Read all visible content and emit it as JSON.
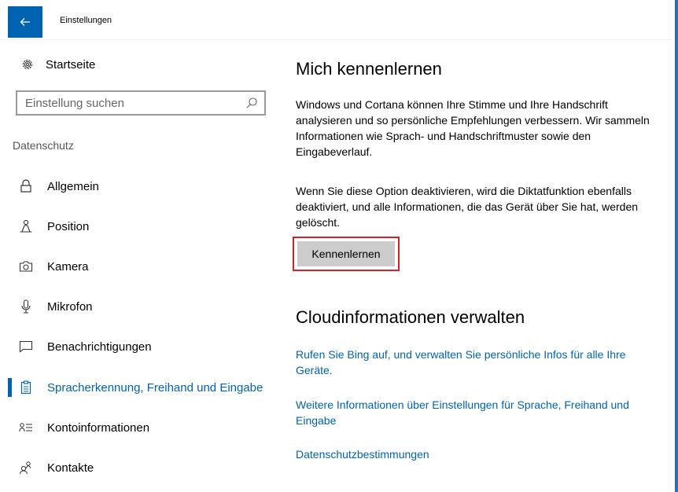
{
  "window": {
    "title": "Einstellungen",
    "back_icon": "back-arrow-icon",
    "accent": "#0063b1"
  },
  "sidebar": {
    "home_label": "Startseite",
    "search_placeholder": "Einstellung suchen",
    "section_title": "Datenschutz",
    "items": [
      {
        "label": "Allgemein",
        "icon": "lock-icon"
      },
      {
        "label": "Position",
        "icon": "person-location-icon"
      },
      {
        "label": "Kamera",
        "icon": "camera-icon"
      },
      {
        "label": "Mikrofon",
        "icon": "microphone-icon"
      },
      {
        "label": "Benachrichtigungen",
        "icon": "notification-icon"
      },
      {
        "label": "Spracherkennung, Freihand und Eingabe",
        "icon": "clipboard-icon",
        "active": true
      },
      {
        "label": "Kontoinformationen",
        "icon": "account-info-icon"
      },
      {
        "label": "Kontakte",
        "icon": "contacts-icon"
      }
    ]
  },
  "main": {
    "heading1": "Mich kennenlernen",
    "para1": "Windows und Cortana können Ihre Stimme und Ihre Handschrift analysieren und so persönliche Empfehlungen verbessern. Wir sammeln Informationen wie Sprach- und Handschriftmuster sowie den Eingabeverlauf.",
    "para2": "Wenn Sie diese Option deaktivieren, wird die Diktatfunktion ebenfalls deaktiviert, und alle Informationen, die das Gerät über Sie hat, werden gelöscht.",
    "button_label": "Kennenlernen",
    "heading2": "Cloudinformationen verwalten",
    "link1": "Rufen Sie Bing auf, und verwalten Sie persönliche Infos für alle Ihre Geräte.",
    "link2": "Weitere Informationen über Einstellungen für Sprache, Freihand und Eingabe",
    "link3": "Datenschutzbestimmungen"
  }
}
